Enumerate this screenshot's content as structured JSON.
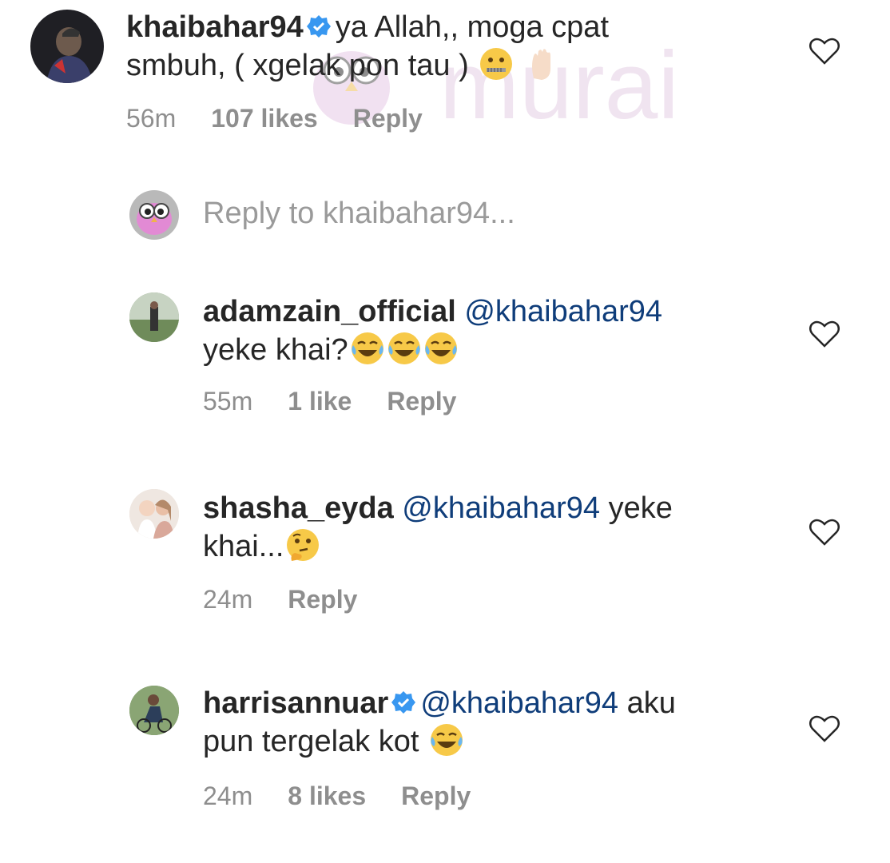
{
  "comments": [
    {
      "username": "khaibahar94",
      "verified": true,
      "mention": "",
      "text_line1": "ya Allah,, moga cpat",
      "text_line2": "smbuh, ( xgelak pon tau )",
      "time": "56m",
      "likes": "107 likes",
      "reply": "Reply",
      "emojis": [
        "zipper-mouth-face",
        "raised-hand-light-skin"
      ]
    },
    {
      "username": "adamzain_official",
      "verified": false,
      "mention": "@khaibahar94",
      "text_line1": "",
      "text_line2": "yeke khai?",
      "time": "55m",
      "likes": "1 like",
      "reply": "Reply",
      "emojis": [
        "face-with-tears-of-joy",
        "face-with-tears-of-joy",
        "face-with-tears-of-joy"
      ]
    },
    {
      "username": "shasha_eyda",
      "verified": false,
      "mention": "@khaibahar94",
      "text_line1": "yeke",
      "text_line2": "khai...",
      "time": "24m",
      "likes": "",
      "reply": "Reply",
      "emojis": [
        "thinking-face"
      ]
    },
    {
      "username": "harrisannuar",
      "verified": true,
      "mention": "@khaibahar94",
      "text_line1": "aku",
      "text_line2": "pun tergelak kot",
      "time": "24m",
      "likes": "8 likes",
      "reply": "Reply",
      "emojis": [
        "face-with-tears-of-joy"
      ]
    }
  ],
  "reply_input": {
    "placeholder": "Reply to khaibahar94..."
  },
  "watermark": {
    "text": "murai"
  },
  "colors": {
    "mention": "#0f3d7a",
    "meta": "#8e8e8e",
    "verified": "#3897f0",
    "watermark": "#d9b8d8"
  }
}
